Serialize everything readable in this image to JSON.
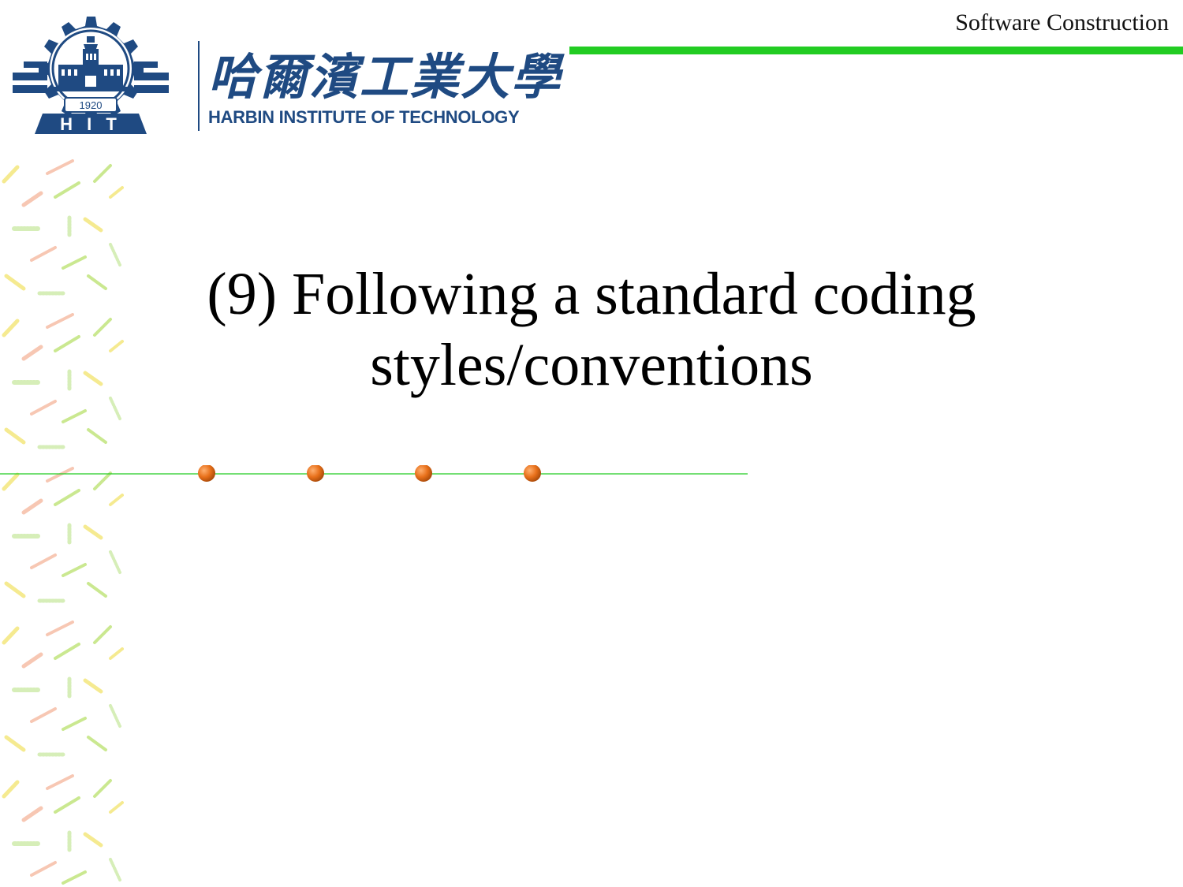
{
  "header": {
    "course_name": "Software Construction"
  },
  "logo": {
    "emblem_year": "1920",
    "emblem_letters": "H I T",
    "name_cn": "哈爾濱工業大學",
    "name_en": "HARBIN INSTITUTE OF TECHNOLOGY",
    "color": "#1f4a82"
  },
  "slide": {
    "title_line1": "(9) Following a standard coding",
    "title_line2": "styles/conventions"
  },
  "colors": {
    "accent_green": "#22cc22",
    "bullet_orange": "#e8701a",
    "decor_leaf_colors": [
      "#b8e06a",
      "#f4b49a",
      "#f2e36a",
      "#c8e8a0"
    ]
  },
  "decor": {
    "bullet_count": 4
  }
}
